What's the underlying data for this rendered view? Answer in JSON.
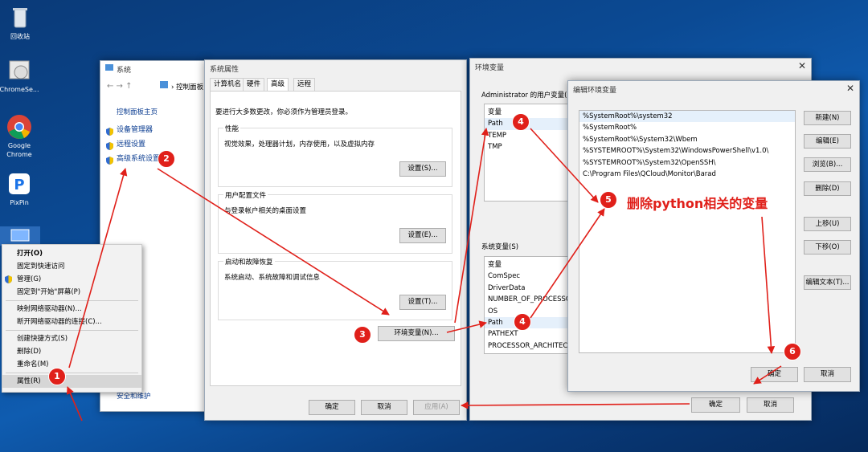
{
  "desktop": {
    "icons": [
      "回收站",
      "ChromeSe...",
      "Google Chrome",
      "PixPin"
    ]
  },
  "context_menu": {
    "items": [
      "打开(O)",
      "固定到快速访问",
      "管理(G)",
      "固定到\"开始\"屏幕(P)",
      "映射网络驱动器(N)...",
      "断开网络驱动器的连接(C)...",
      "创建快捷方式(S)",
      "删除(D)",
      "重命名(M)",
      "属性(R)"
    ]
  },
  "system_window": {
    "title": "系统",
    "breadcrumb": "控制面板",
    "home_link": "控制面板主页",
    "links": [
      "设备管理器",
      "远程设置",
      "高级系统设置"
    ],
    "bottom_link": "安全和维护"
  },
  "sysprops": {
    "title": "系统属性",
    "tabs": [
      "计算机名",
      "硬件",
      "高级",
      "远程"
    ],
    "admin_note": "要进行大多数更改，你必须作为管理员登录。",
    "perf_title": "性能",
    "perf_desc": "视觉效果，处理器计划，内存使用，以及虚拟内存",
    "profile_title": "用户配置文件",
    "profile_desc": "与登录帐户相关的桌面设置",
    "startup_title": "启动和故障恢复",
    "startup_desc": "系统启动、系统故障和调试信息",
    "settings_btn": "设置(S)...",
    "settings_btn_e": "设置(E)...",
    "settings_btn_t": "设置(T)...",
    "env_btn": "环境变量(N)...",
    "ok": "确定",
    "cancel": "取消",
    "apply": "应用(A)"
  },
  "envvars": {
    "title": "环境变量",
    "user_label": "Administrator 的用户变量(U)",
    "user_header": "变量",
    "user_vars": [
      "Path",
      "TEMP",
      "TMP"
    ],
    "sys_label": "系统变量(S)",
    "sys_header": "变量",
    "sys_vars": [
      "ComSpec",
      "DriverData",
      "NUMBER_OF_PROCESSORS",
      "OS",
      "Path",
      "PATHEXT",
      "PROCESSOR_ARCHITECTURE"
    ],
    "ok": "确定",
    "cancel": "取消"
  },
  "editenv": {
    "title": "编辑环境变量",
    "entries": [
      "%SystemRoot%\\system32",
      "%SystemRoot%",
      "%SystemRoot%\\System32\\Wbem",
      "%SYSTEMROOT%\\System32\\WindowsPowerShell\\v1.0\\",
      "%SYSTEMROOT%\\System32\\OpenSSH\\",
      "C:\\Program Files\\QCloud\\Monitor\\Barad"
    ],
    "buttons": [
      "新建(N)",
      "编辑(E)",
      "浏览(B)...",
      "删除(D)",
      "上移(U)",
      "下移(O)",
      "编辑文本(T)..."
    ],
    "ok": "确定",
    "cancel": "取消"
  },
  "annotation": {
    "steps": [
      "1",
      "2",
      "3",
      "4",
      "4",
      "5",
      "6"
    ],
    "note": "删除python相关的变量",
    "color": "#e0201a"
  }
}
